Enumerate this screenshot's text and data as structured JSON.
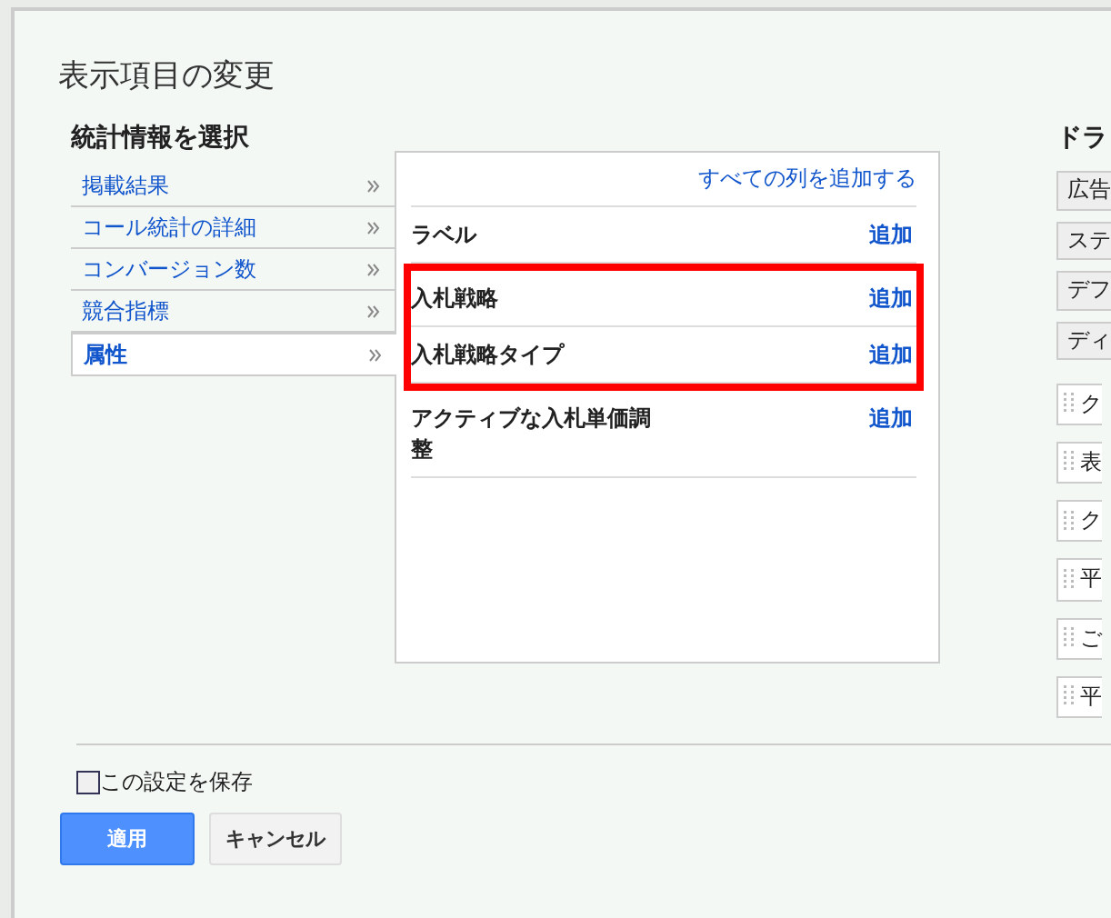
{
  "dialog": {
    "title": "表示項目の変更"
  },
  "categories": {
    "heading": "統計情報を選択",
    "items": [
      {
        "label": "掲載結果",
        "selected": false
      },
      {
        "label": "コール統計の詳細",
        "selected": false
      },
      {
        "label": "コンバージョン数",
        "selected": false
      },
      {
        "label": "競合指標",
        "selected": false
      },
      {
        "label": "属性",
        "selected": true
      }
    ]
  },
  "columns_panel": {
    "add_all": "すべての列を追加する",
    "rows": [
      {
        "name": "ラベル",
        "action": "追加",
        "highlighted": false
      },
      {
        "name": "入札戦略",
        "action": "追加",
        "highlighted": true
      },
      {
        "name": "入札戦略タイプ",
        "action": "追加",
        "highlighted": true
      },
      {
        "name": "アクティブな入札単価調整",
        "action": "追加",
        "highlighted": false
      }
    ]
  },
  "selected_columns": {
    "heading": "ドラ",
    "fixed": [
      "広告",
      "ステ",
      "デフ",
      "ディ"
    ],
    "draggable": [
      "ク",
      "表",
      "ク",
      "平",
      "ご",
      "平"
    ]
  },
  "save_setting": {
    "label": "この設定を保存",
    "checked": false
  },
  "buttons": [
    {
      "label": "適用",
      "kind": "primary"
    },
    {
      "label": "キャンセル",
      "kind": "secondary"
    }
  ]
}
